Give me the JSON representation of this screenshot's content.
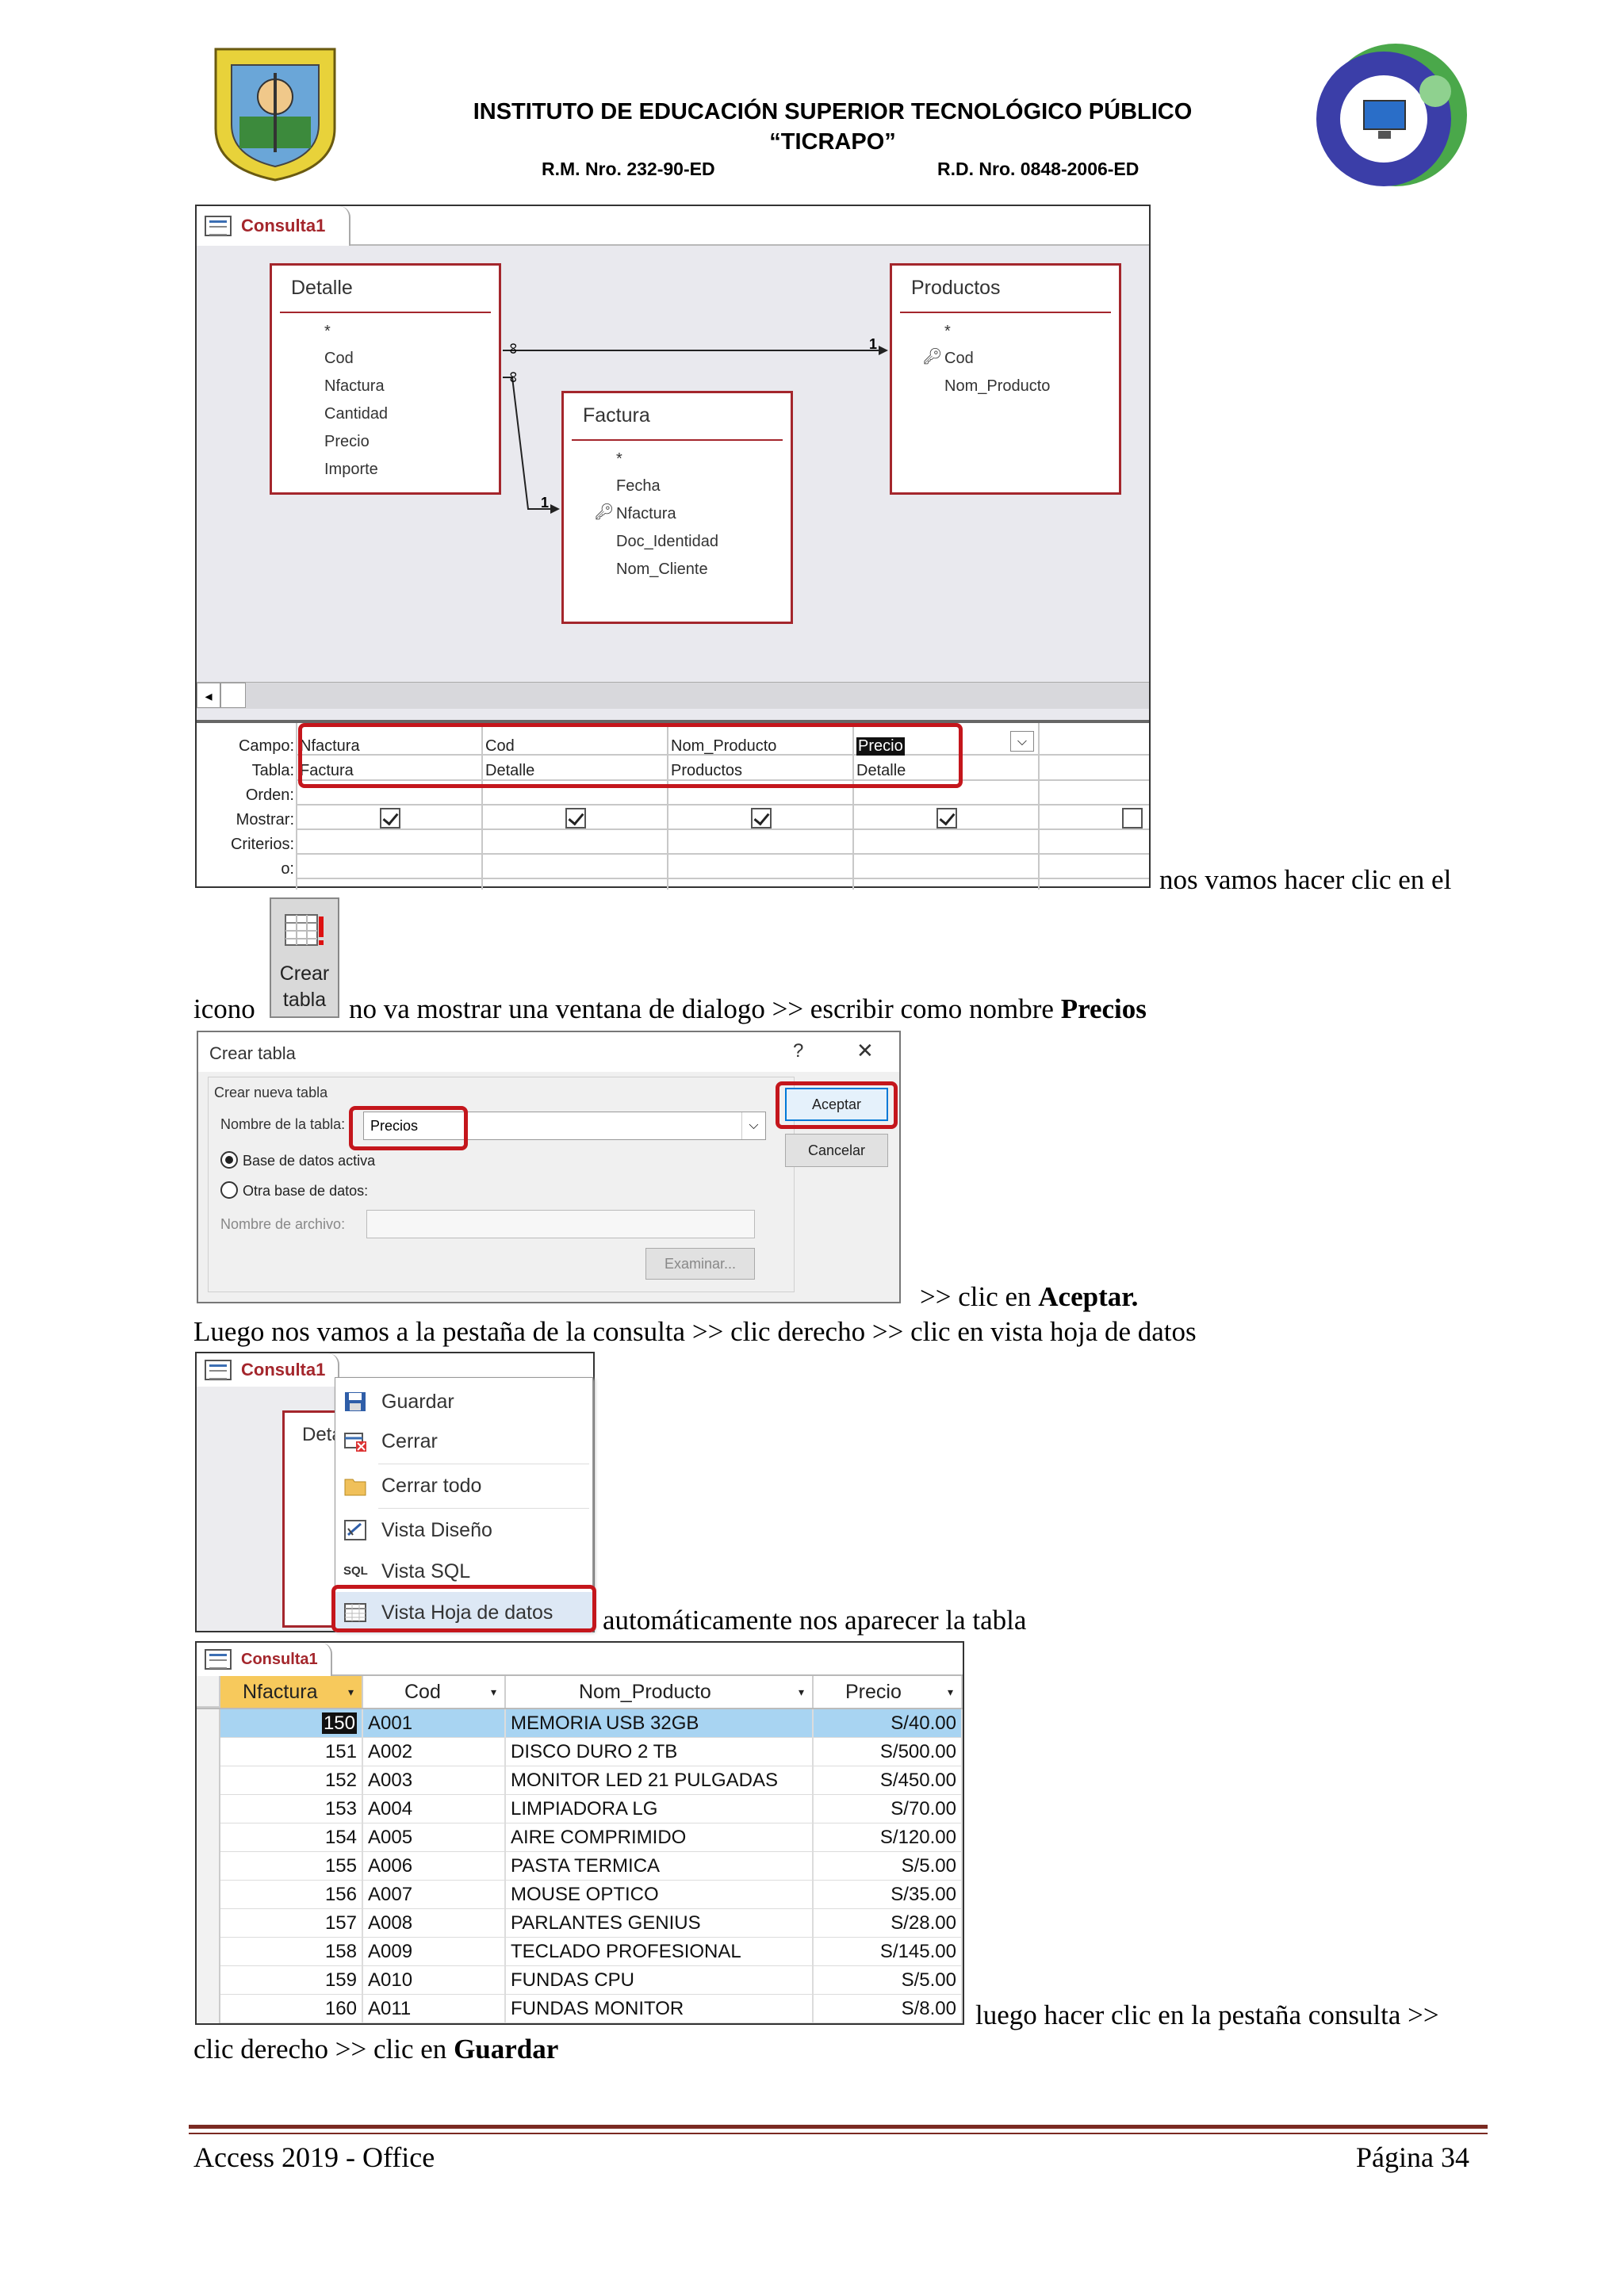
{
  "header": {
    "title1": "INSTITUTO DE EDUCACIÓN SUPERIOR TECNOLÓGICO PÚBLICO",
    "title2": "“TICRAPO”",
    "rm": "R.M. Nro. 232-90-ED",
    "rd": "R.D. Nro. 0848-2006-ED"
  },
  "query_design": {
    "tab": "Consulta1",
    "tables": {
      "detalle": {
        "name": "Detalle",
        "fields": [
          "*",
          "Cod",
          "Nfactura",
          "Cantidad",
          "Precio",
          "Importe"
        ]
      },
      "productos": {
        "name": "Productos",
        "fields": [
          "*",
          "Cod",
          "Nom_Producto"
        ]
      },
      "factura": {
        "name": "Factura",
        "fields": [
          "*",
          "Fecha",
          "Nfactura",
          "Doc_Identidad",
          "Nom_Cliente"
        ]
      }
    },
    "rel_many": "∞",
    "rel_one": "1",
    "row_labels": [
      "Campo:",
      "Tabla:",
      "Orden:",
      "Mostrar:",
      "Criterios:",
      "o:"
    ],
    "campos": [
      "Nfactura",
      "Cod",
      "Nom_Producto",
      "Precio"
    ],
    "tablas": [
      "Factura",
      "Detalle",
      "Productos",
      "Detalle"
    ]
  },
  "text1": "nos vamos hacer clic en el",
  "crear_tabla_icon": {
    "line1": "Crear",
    "line2": "tabla"
  },
  "text2_pre": "icono",
  "text2_mid": "no va mostrar una ventana de dialogo >> escribir como nombre ",
  "text2_bold": "Precios",
  "dialog": {
    "title": "Crear tabla",
    "help": "?",
    "close": "✕",
    "section": "Crear nueva tabla",
    "name_label": "Nombre de la tabla:",
    "name_value": "Precios",
    "radio1": "Base de datos activa",
    "radio2": "Otra base de datos:",
    "file_label": "Nombre de archivo:",
    "browse": "Examinar...",
    "ok": "Aceptar",
    "cancel": "Cancelar"
  },
  "text3_pre": ">> clic en ",
  "text3_bold": "Aceptar.",
  "text4": "Luego nos vamos a la pestaña de la consulta >> clic derecho >> clic en vista hoja de datos",
  "context": {
    "tab": "Consulta1",
    "behind": "Deta",
    "items": [
      "Guardar",
      "Cerrar",
      "Cerrar todo",
      "Vista Diseño",
      "Vista SQL",
      "Vista Hoja de datos"
    ],
    "sql_tag": "SQL"
  },
  "text5": "automáticamente nos aparecer la tabla",
  "datasheet": {
    "tab": "Consulta1",
    "columns": [
      "Nfactura",
      "Cod",
      "Nom_Producto",
      "Precio"
    ],
    "rows": [
      [
        "150",
        "A001",
        "MEMORIA USB 32GB",
        "S/40.00"
      ],
      [
        "151",
        "A002",
        "DISCO DURO 2 TB",
        "S/500.00"
      ],
      [
        "152",
        "A003",
        "MONITOR LED 21 PULGADAS",
        "S/450.00"
      ],
      [
        "153",
        "A004",
        "LIMPIADORA LG",
        "S/70.00"
      ],
      [
        "154",
        "A005",
        "AIRE COMPRIMIDO",
        "S/120.00"
      ],
      [
        "155",
        "A006",
        "PASTA TERMICA",
        "S/5.00"
      ],
      [
        "156",
        "A007",
        "MOUSE OPTICO",
        "S/35.00"
      ],
      [
        "157",
        "A008",
        "PARLANTES GENIUS",
        "S/28.00"
      ],
      [
        "158",
        "A009",
        "TECLADO PROFESIONAL",
        "S/145.00"
      ],
      [
        "159",
        "A010",
        "FUNDAS CPU",
        "S/5.00"
      ],
      [
        "160",
        "A011",
        "FUNDAS MONITOR",
        "S/8.00"
      ]
    ]
  },
  "text6": "luego hacer clic en la pestaña consulta >>",
  "text7_pre": "clic derecho >> clic en ",
  "text7_bold": "Guardar",
  "footer": {
    "left": "Access 2019 - Office",
    "right": "Página 34"
  },
  "colors": {
    "accent_red": "#a4262c",
    "highlight_red": "#c4161c",
    "selected_row": "#a8d4f2",
    "header_yellow": "#f7c95c"
  }
}
